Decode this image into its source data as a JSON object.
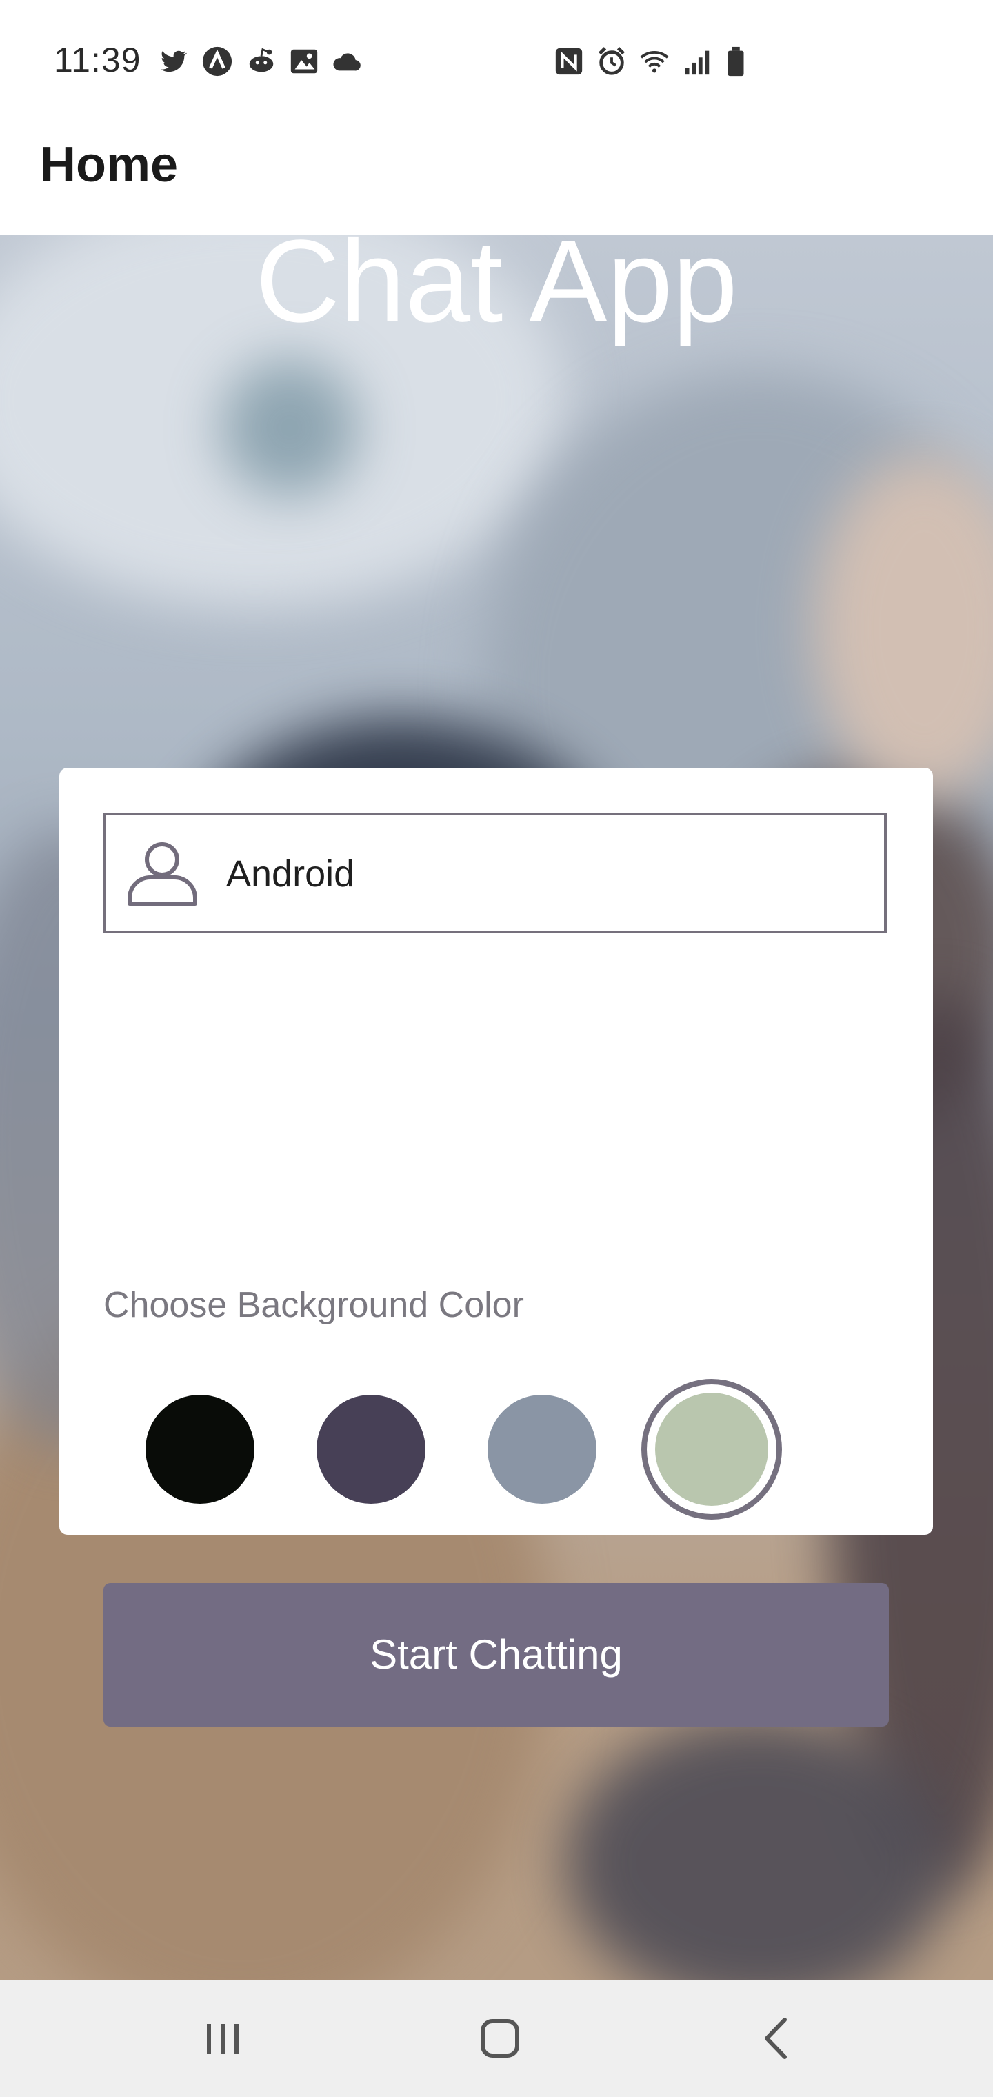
{
  "status_bar": {
    "time": "11:39",
    "left_icons": [
      "twitter-icon",
      "app-a-icon",
      "reddit-icon",
      "gallery-icon",
      "cloud-icon"
    ],
    "right_icons": [
      "nfc-icon",
      "alarm-icon",
      "wifi-icon",
      "signal-icon",
      "battery-icon"
    ]
  },
  "app_bar": {
    "title": "Home"
  },
  "hero": {
    "title": "Chat App"
  },
  "form": {
    "name_value": "Android",
    "choose_label": "Choose Background Color",
    "colors": [
      {
        "name": "black",
        "hex": "#090c08"
      },
      {
        "name": "dark-purple",
        "hex": "#474056"
      },
      {
        "name": "slate-blue",
        "hex": "#8a95a5"
      },
      {
        "name": "sage-green",
        "hex": "#b9c6ae"
      }
    ],
    "selected_color": "#b9c6ae",
    "start_button": "Start Chatting"
  },
  "nav": {
    "buttons": [
      "recent-apps-icon",
      "home-icon",
      "back-icon"
    ]
  }
}
